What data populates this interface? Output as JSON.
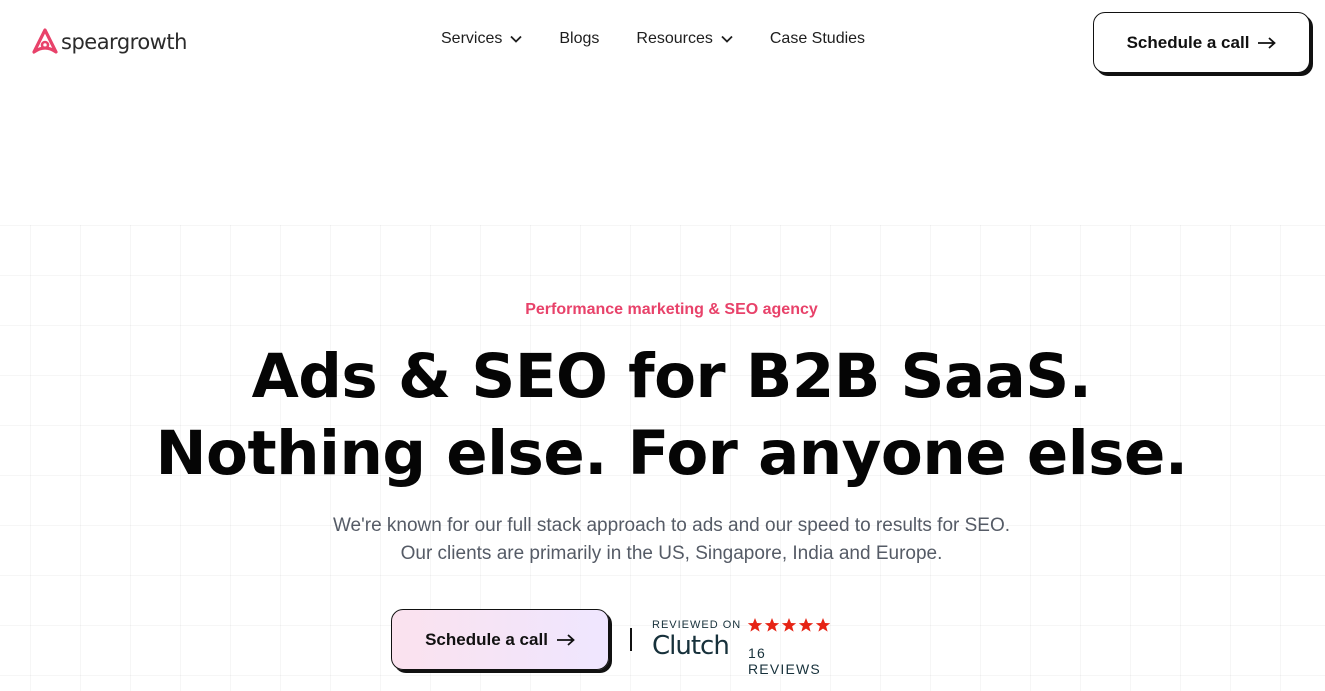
{
  "brand": {
    "name": "speargrowth",
    "accent_color": "#e8426a"
  },
  "nav": {
    "items": [
      {
        "label": "Services",
        "has_dropdown": true
      },
      {
        "label": "Blogs",
        "has_dropdown": false
      },
      {
        "label": "Resources",
        "has_dropdown": true
      },
      {
        "label": "Case Studies",
        "has_dropdown": false
      }
    ],
    "cta_label": "Schedule a call",
    "cta_icon": "arrow-right-icon"
  },
  "hero": {
    "eyebrow": "Performance marketing & SEO agency",
    "headline_line1": "Ads & SEO for B2B SaaS.",
    "headline_line2": "Nothing else. For anyone else.",
    "subtext_line1": "We're known for our full stack approach to ads and our speed to results for SEO.",
    "subtext_line2": "Our clients are primarily in the US, Singapore, India and Europe.",
    "cta_label": "Schedule a call",
    "cta_gradient": [
      "#fbe2ee",
      "#efe6ff"
    ]
  },
  "clutch": {
    "reviewed_on": "REVIEWED ON",
    "brand_word": "Clutch",
    "rating_stars": 5,
    "star_color": "#e62415",
    "reviews": "16 REVIEWS"
  }
}
